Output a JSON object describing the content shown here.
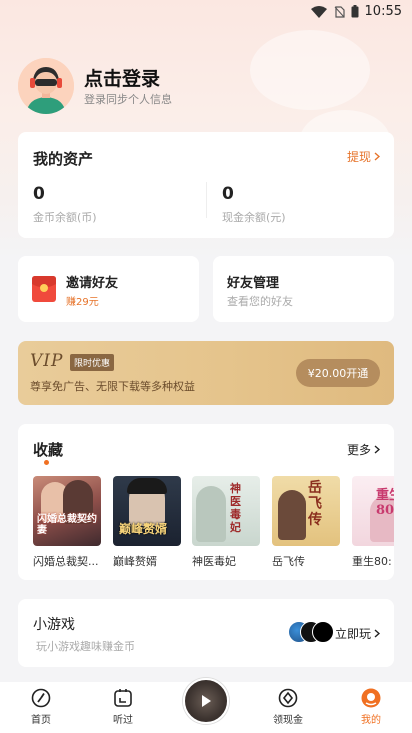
{
  "status_bar": {
    "time": "10:55"
  },
  "profile": {
    "title": "点击登录",
    "subtitle": "登录同步个人信息"
  },
  "assets": {
    "title": "我的资产",
    "withdraw_label": "提现",
    "gold": {
      "value": "0",
      "label": "金币余额(币)"
    },
    "cash": {
      "value": "0",
      "label": "现金余额(元)"
    }
  },
  "invite": {
    "title": "邀请好友",
    "subtitle": "赚29元"
  },
  "friends": {
    "title": "好友管理",
    "subtitle": "查看您的好友"
  },
  "vip": {
    "logo": "VIP",
    "tag": "限时优惠",
    "description": "尊享免广告、无限下载等多种权益",
    "button": "¥20.00开通"
  },
  "favorites": {
    "title": "收藏",
    "more_label": "更多",
    "books": [
      {
        "name": "闪婚总裁契...",
        "cover_text": "闪婚总裁契约妻"
      },
      {
        "name": "巅峰赘婿",
        "cover_text": "巅峰赘婿"
      },
      {
        "name": "神医毒妃",
        "cover_text": "神医毒妃"
      },
      {
        "name": "岳飞传",
        "cover_text": "岳飞传"
      },
      {
        "name": "重生80:",
        "cover_text": "重生80"
      }
    ]
  },
  "games": {
    "title": "小游戏",
    "subtitle": "玩小游戏趣味赚金币",
    "action": "立即玩"
  },
  "tabbar": {
    "items": [
      {
        "label": "首页",
        "icon": "home-dial-icon"
      },
      {
        "label": "听过",
        "icon": "history-icon"
      },
      {
        "label": "",
        "icon": "play-icon"
      },
      {
        "label": "领现金",
        "icon": "cash-icon"
      },
      {
        "label": "我的",
        "icon": "profile-icon",
        "active": true
      }
    ]
  },
  "colors": {
    "accent": "#f07022",
    "vip_gold": "#e5c48c",
    "vip_text": "#6b4c2c"
  }
}
